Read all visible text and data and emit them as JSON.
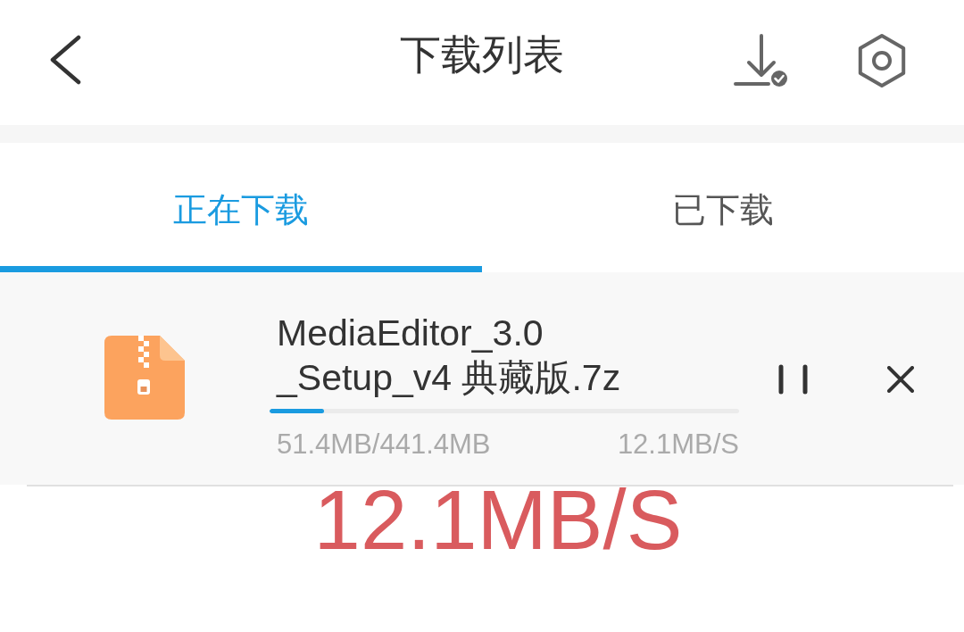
{
  "header": {
    "title": "下载列表"
  },
  "tabs": [
    {
      "label": "正在下载",
      "selected": true
    },
    {
      "label": "已下载",
      "selected": false
    }
  ],
  "downloads": [
    {
      "file_name_lines": [
        "MediaEditor_3.0",
        "_Setup_v4 典藏版.7z"
      ],
      "level": 0.116,
      "downloaded_size": "51.4MB/441.4MB",
      "speed": "12.1MB/S",
      "paused": false
    }
  ],
  "speed_caption": "12.1MB/S"
}
